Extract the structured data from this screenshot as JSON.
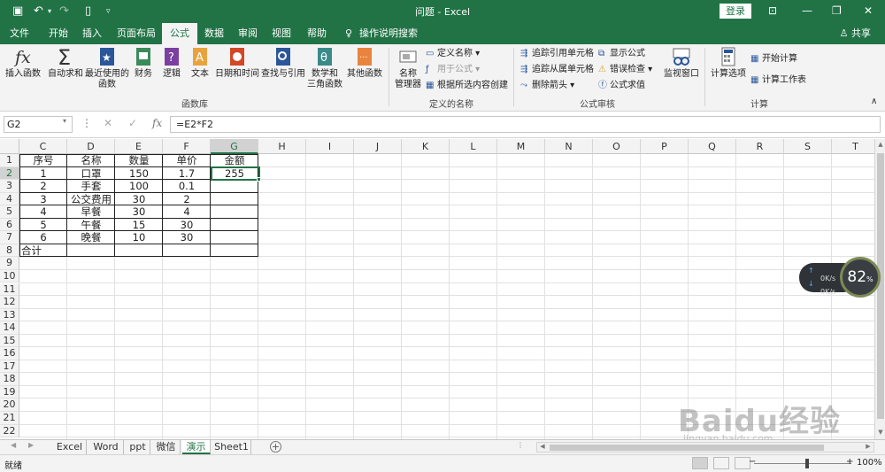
{
  "app": {
    "window_title": "问题 - Excel",
    "login": "登录",
    "share": "共享"
  },
  "tabs": [
    "文件",
    "开始",
    "插入",
    "页面布局",
    "公式",
    "数据",
    "审阅",
    "视图",
    "帮助",
    "操作说明搜索"
  ],
  "active_tab": "公式",
  "ribbon": {
    "function_library": {
      "label": "函数库",
      "buttons": [
        {
          "label": "插入函数",
          "icon": "fx-icon"
        },
        {
          "label": "自动求和",
          "icon": "sigma-icon"
        },
        {
          "label": "最近使用的\n函数",
          "icon": "star-book-icon"
        },
        {
          "label": "财务",
          "icon": "finance-book-icon"
        },
        {
          "label": "逻辑",
          "icon": "question-book-icon"
        },
        {
          "label": "文本",
          "icon": "text-book-icon"
        },
        {
          "label": "日期和时间",
          "icon": "clock-book-icon"
        },
        {
          "label": "查找与引用",
          "icon": "magnifier-book-icon"
        },
        {
          "label": "数学和\n三角函数",
          "icon": "theta-book-icon"
        },
        {
          "label": "其他函数",
          "icon": "more-book-icon"
        }
      ]
    },
    "defined_names": {
      "label": "定义的名称",
      "manager": "名称\n管理器",
      "items": [
        "定义名称",
        "用于公式",
        "根据所选内容创建"
      ]
    },
    "formula_auditing": {
      "label": "公式审核",
      "items": [
        "追踪引用单元格",
        "显示公式",
        "追踪从属单元格",
        "错误检查",
        "删除箭头",
        "公式求值"
      ],
      "watch": "监视窗口"
    },
    "calculation": {
      "label": "计算",
      "options": "计算选项",
      "items": [
        "开始计算",
        "计算工作表"
      ]
    }
  },
  "formula_bar": {
    "name_box": "G2",
    "formula": "=E2*F2"
  },
  "columns": [
    "C",
    "D",
    "E",
    "F",
    "G",
    "H",
    "I",
    "J",
    "K",
    "L",
    "M",
    "N",
    "O",
    "P",
    "Q",
    "R",
    "S",
    "T"
  ],
  "rows": [
    "1",
    "2",
    "3",
    "4",
    "5",
    "6",
    "7",
    "8",
    "9",
    "10",
    "11",
    "12",
    "13",
    "14",
    "15",
    "16",
    "17",
    "18",
    "19",
    "20",
    "21",
    "22"
  ],
  "table": {
    "header": [
      "序号",
      "名称",
      "数量",
      "单价",
      "金额"
    ],
    "rows": [
      [
        "1",
        "口罩",
        "150",
        "1.7",
        "255"
      ],
      [
        "2",
        "手套",
        "100",
        "0.1",
        ""
      ],
      [
        "3",
        "公交费用",
        "30",
        "2",
        ""
      ],
      [
        "4",
        "早餐",
        "30",
        "4",
        ""
      ],
      [
        "5",
        "午餐",
        "15",
        "30",
        ""
      ],
      [
        "6",
        "晚餐",
        "10",
        "30",
        ""
      ]
    ],
    "total_label": "合计"
  },
  "sheets": [
    "Excel",
    "Word",
    "ppt",
    "微信",
    "演示",
    "Sheet1"
  ],
  "active_sheet": "演示",
  "status": {
    "text": "就绪",
    "zoom": "100%"
  },
  "network_widget": {
    "up": "0K/s",
    "down": "0K/s",
    "gauge": "82",
    "gauge_unit": "%"
  },
  "watermark": {
    "main": "Baidu经验",
    "sub": "jingyan.baidu.com"
  }
}
